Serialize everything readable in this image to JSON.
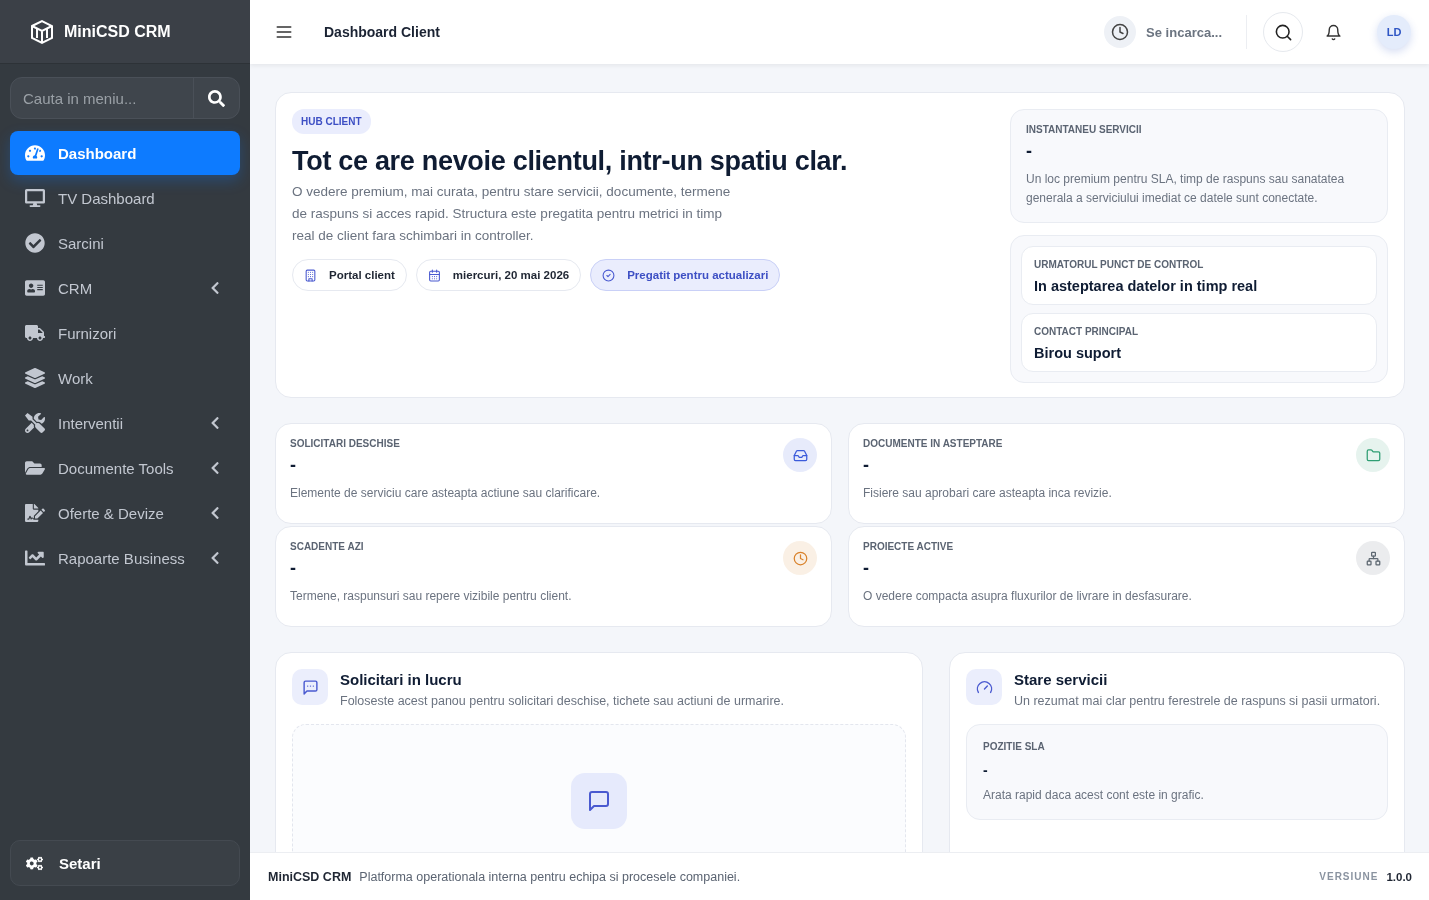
{
  "brand": {
    "name": "MiniCSD CRM"
  },
  "sidebar": {
    "search": {
      "placeholder": "Cauta in meniu..."
    },
    "items": [
      {
        "label": "Dashboard",
        "selected": true,
        "expandable": false
      },
      {
        "label": "TV Dashboard",
        "selected": false,
        "expandable": false
      },
      {
        "label": "Sarcini",
        "selected": false,
        "expandable": false
      },
      {
        "label": "CRM",
        "selected": false,
        "expandable": true
      },
      {
        "label": "Furnizori",
        "selected": false,
        "expandable": false
      },
      {
        "label": "Work",
        "selected": false,
        "expandable": false
      },
      {
        "label": "Interventii",
        "selected": false,
        "expandable": true
      },
      {
        "label": "Documente Tools",
        "selected": false,
        "expandable": true
      },
      {
        "label": "Oferte & Devize",
        "selected": false,
        "expandable": true
      },
      {
        "label": "Rapoarte Business",
        "selected": false,
        "expandable": true
      }
    ],
    "settings": {
      "label": "Setari"
    }
  },
  "header": {
    "title": "Dashboard Client",
    "clock": "Se incarca...",
    "avatar": "LD"
  },
  "hero": {
    "badge": "HUB CLIENT",
    "title": "Tot ce are nevoie clientul, intr-un spatiu clar.",
    "text": "O vedere premium, mai curata, pentru stare servicii, documente, termene de raspuns si acces rapid. Structura este pregatita pentru metrici in timp real de client fara schimbari in controller.",
    "chips": [
      {
        "label": "Portal client",
        "highlighted": false
      },
      {
        "label": "miercuri, 20 mai 2026",
        "highlighted": false
      },
      {
        "label": "Pregatit pentru actualizari",
        "highlighted": true
      }
    ],
    "snapshot": {
      "label": "INSTANTANEU SERVICII",
      "value": "-",
      "text": "Un loc premium pentru SLA, timp de raspuns sau sanatatea generala a serviciului imediat ce datele sunt conectate."
    },
    "facts": [
      {
        "label": "URMATORUL PUNCT DE CONTROL",
        "value": "In asteptarea datelor in timp real"
      },
      {
        "label": "CONTACT PRINCIPAL",
        "value": "Birou suport"
      }
    ]
  },
  "stats": [
    {
      "label": "SOLICITARI DESCHISE",
      "value": "-",
      "text": "Elemente de serviciu care asteapta actiune sau clarificare.",
      "color": "#3b5bdb"
    },
    {
      "label": "DOCUMENTE IN ASTEPTARE",
      "value": "-",
      "text": "Fisiere sau aprobari care asteapta inca revizie.",
      "color": "#2f9e73"
    },
    {
      "label": "SCADENTE AZI",
      "value": "-",
      "text": "Termene, raspunsuri sau repere vizibile pentru client.",
      "color": "#d9822b"
    },
    {
      "label": "PROIECTE ACTIVE",
      "value": "-",
      "text": "O vedere compacta asupra fluxurilor de livrare in desfasurare.",
      "color": "#5c6670"
    }
  ],
  "requests_panel": {
    "title": "Solicitari in lucru",
    "subtitle": "Foloseste acest panou pentru solicitari deschise, tichete sau actiuni de urmarire."
  },
  "services_panel": {
    "title": "Stare servicii",
    "subtitle": "Un rezumat mai clar pentru ferestrele de raspuns si pasii urmatori.",
    "card": {
      "label": "POZITIE SLA",
      "value": "-",
      "text": "Arata rapid daca acest cont este in grafic."
    }
  },
  "footer": {
    "brand": "MiniCSD CRM",
    "text": "Platforma operationala interna pentru echipa si procesele companiei.",
    "version_label": "VERSIUNE",
    "version": "1.0.0"
  }
}
